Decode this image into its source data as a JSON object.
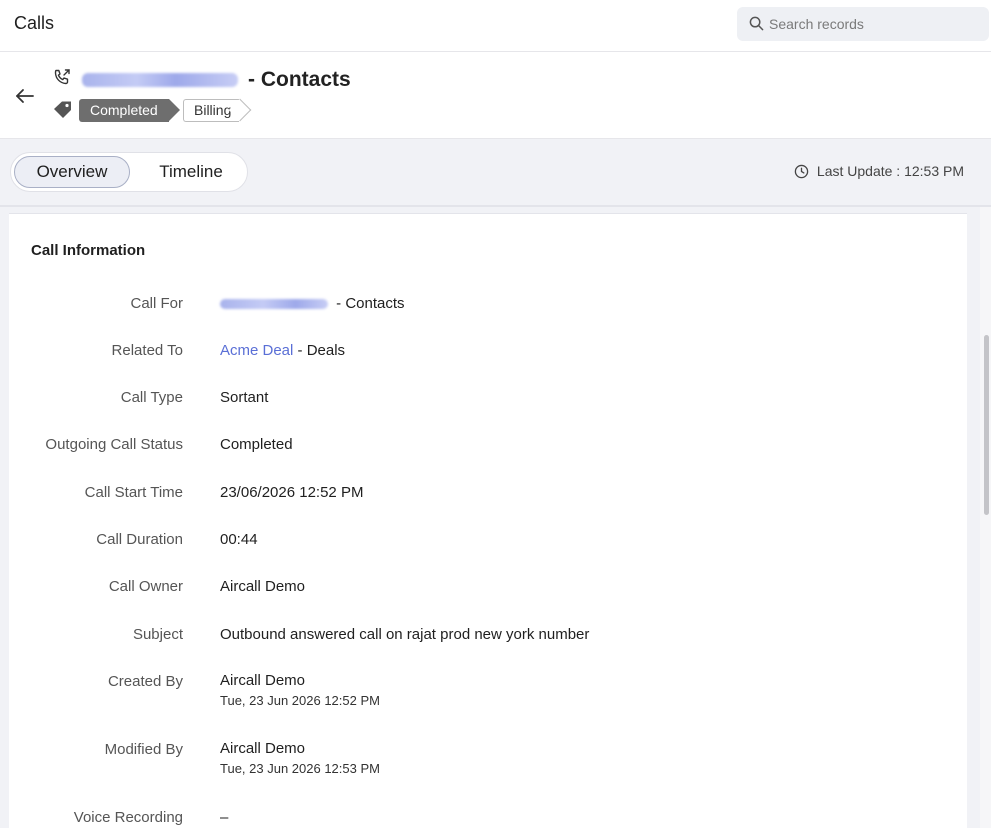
{
  "app": {
    "title": "Calls"
  },
  "search": {
    "placeholder": "Search records"
  },
  "record": {
    "title_suffix": "- Contacts",
    "tags": {
      "status": "Completed",
      "category": "Billing"
    }
  },
  "tabs": [
    {
      "label": "Overview",
      "active": true
    },
    {
      "label": "Timeline",
      "active": false
    }
  ],
  "last_update": "Last Update : 12:53 PM",
  "section": {
    "title": "Call Information"
  },
  "fields": {
    "call_for": {
      "label": "Call For",
      "suffix": " - Contacts"
    },
    "related_to": {
      "label": "Related To",
      "link": "Acme Deal",
      "suffix": " - Deals"
    },
    "call_type": {
      "label": "Call Type",
      "value": "Sortant"
    },
    "outgoing_status": {
      "label": "Outgoing Call Status",
      "value": "Completed"
    },
    "start_time": {
      "label": "Call Start Time",
      "value": "23/06/2026 12:52 PM"
    },
    "duration": {
      "label": "Call Duration",
      "value": "00:44"
    },
    "owner": {
      "label": "Call Owner",
      "value": "Aircall Demo"
    },
    "subject": {
      "label": "Subject",
      "value": "Outbound answered call on rajat prod new york number"
    },
    "created_by": {
      "label": "Created By",
      "value": "Aircall Demo",
      "sub": "Tue, 23 Jun 2026 12:52 PM"
    },
    "modified_by": {
      "label": "Modified By",
      "value": "Aircall Demo",
      "sub": "Tue, 23 Jun 2026 12:53 PM"
    },
    "voice_recording": {
      "label": "Voice Recording",
      "value": "–"
    }
  },
  "colors": {
    "accent_link": "#5a6fd6",
    "tag_completed": "#6e6e6e",
    "page_bg": "#f1f2f6"
  },
  "icons": [
    "search-icon",
    "back-arrow-icon",
    "outgoing-call-icon",
    "tag-icon",
    "clock-icon"
  ]
}
